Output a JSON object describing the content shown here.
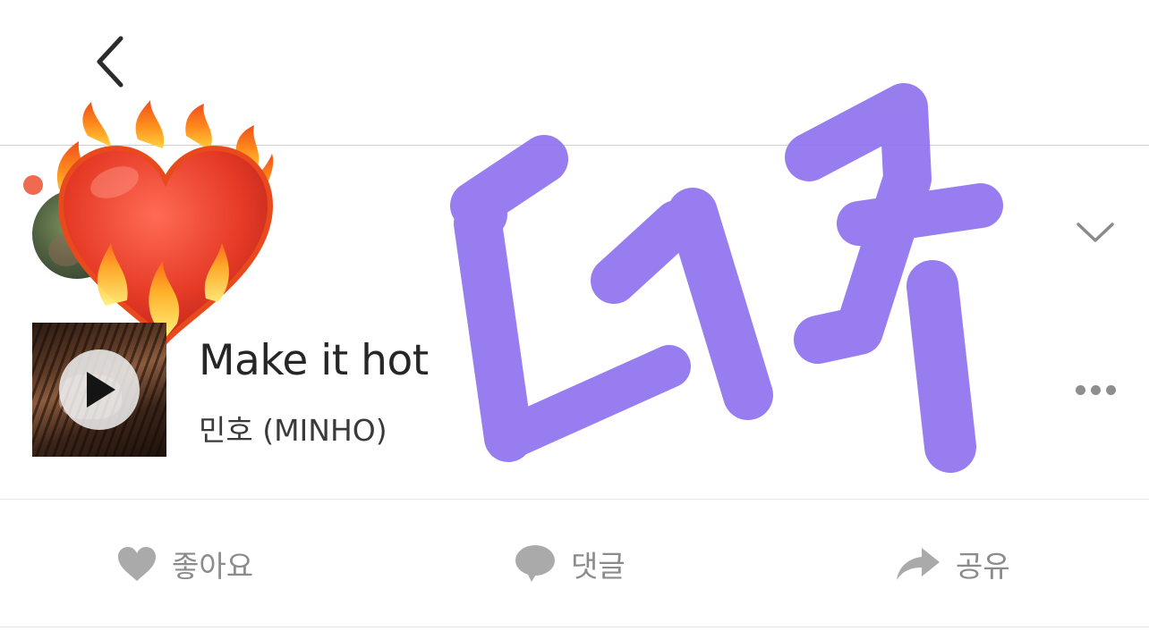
{
  "header": {
    "back_icon": "chevron-left-icon"
  },
  "post": {
    "status_dot_color": "#ee6a50",
    "avatar": "profile-avatar",
    "overlay_sticker": "heart-on-fire-emoji",
    "expand_icon": "chevron-down-icon",
    "more_icon": "ellipsis-icon",
    "doodle_text": "더 ㅋ",
    "doodle_color": "#8f72ee"
  },
  "music": {
    "title": "Make it hot",
    "artist": "민호 (MINHO)",
    "play_icon": "play-icon"
  },
  "actions": {
    "like_label": "좋아요",
    "like_icon": "heart-icon",
    "comment_label": "댓글",
    "comment_icon": "speech-bubble-icon",
    "share_label": "공유",
    "share_icon": "share-arrow-icon",
    "icon_color": "#aaaaaa"
  }
}
